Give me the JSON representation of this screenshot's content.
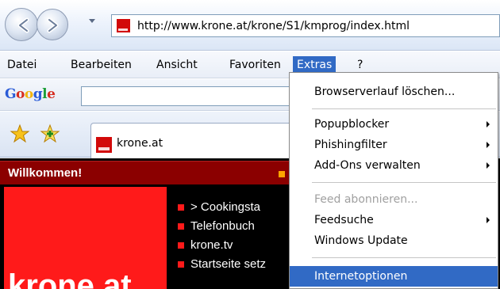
{
  "address_bar": {
    "url": "http://www.krone.at/krone/S1/kmprog/index.html"
  },
  "menu_bar": {
    "items": [
      "Datei",
      "Bearbeiten",
      "Ansicht",
      "Favoriten",
      "Extras",
      "?"
    ],
    "active": "Extras"
  },
  "google_toolbar": {
    "logo": "Google"
  },
  "tabs": {
    "active_label": "krone.at"
  },
  "page": {
    "welcome": "Willkommen!",
    "links": [
      "> Cookingsta",
      "Telefonbuch",
      "krone.tv",
      "Startseite setz"
    ],
    "logo_text": "krone.at"
  },
  "extras_menu": {
    "items": [
      {
        "label": "Browserverlauf löschen...",
        "submenu": false,
        "enabled": true
      },
      {
        "label": "Popupblocker",
        "submenu": true,
        "enabled": true
      },
      {
        "label": "Phishingfilter",
        "submenu": true,
        "enabled": true
      },
      {
        "label": "Add-Ons verwalten",
        "submenu": true,
        "enabled": true
      },
      {
        "label": "Feed abonnieren...",
        "submenu": false,
        "enabled": false
      },
      {
        "label": "Feedsuche",
        "submenu": true,
        "enabled": true
      },
      {
        "label": "Windows Update",
        "submenu": false,
        "enabled": true
      },
      {
        "label": "Internetoptionen",
        "submenu": false,
        "enabled": true,
        "highlighted": true
      }
    ]
  },
  "colors": {
    "highlight": "#316ac5",
    "brand_red": "#ff1a1a",
    "welcome_bg": "#8b0000"
  }
}
